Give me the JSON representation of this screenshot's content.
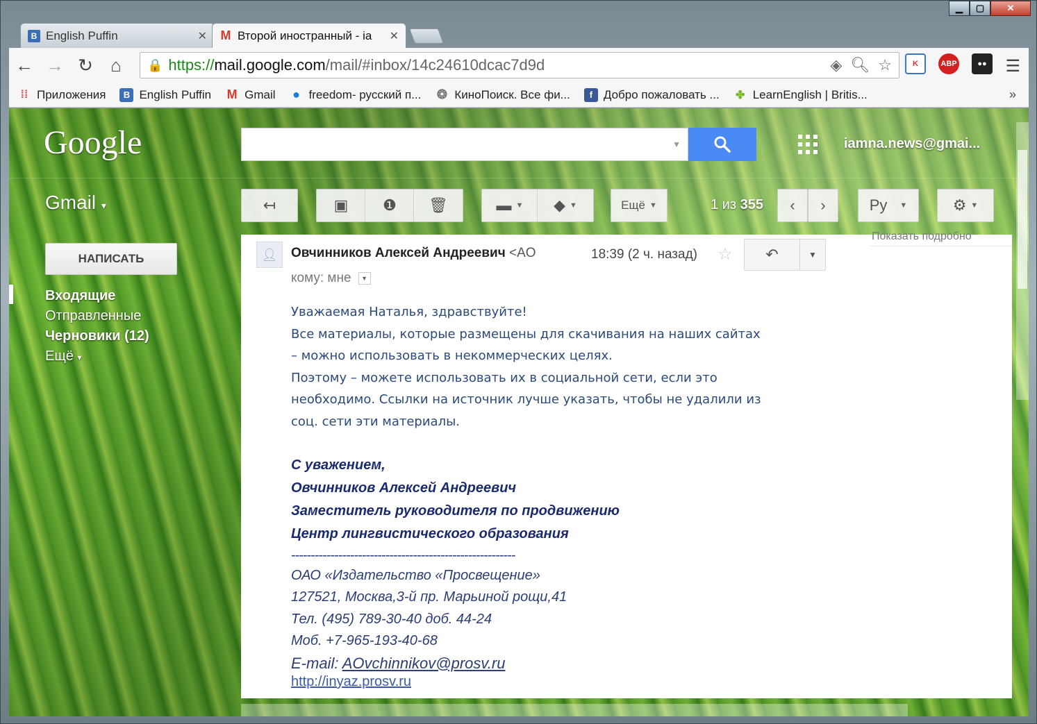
{
  "browser": {
    "tabs": [
      {
        "title": "English Puffin",
        "favicon": "B"
      },
      {
        "title": "Второй иностранный - ia",
        "favicon": "M"
      }
    ],
    "url": {
      "scheme": "https://",
      "host": "mail.google.com",
      "path": "/mail/#inbox/14c24610dcac7d9d"
    },
    "bookmarks": [
      {
        "label": "Приложения",
        "icon": "apps-icon"
      },
      {
        "label": "English Puffin",
        "icon": "blogger-icon"
      },
      {
        "label": "Gmail",
        "icon": "gmail-icon"
      },
      {
        "label": "freedom- русский п...",
        "icon": "chat-bubble-icon"
      },
      {
        "label": "КиноПоиск. Все фи...",
        "icon": "film-reel-icon"
      },
      {
        "label": "Добро пожаловать ...",
        "icon": "facebook-icon"
      },
      {
        "label": "LearnEnglish | Britis...",
        "icon": "learnenglish-icon"
      }
    ],
    "bookmarks_more": "»"
  },
  "gmail": {
    "logo": "Google",
    "account": "iamna.news@gmai...",
    "app_label": "Gmail",
    "compose_label": "НАПИСАТЬ",
    "folders": [
      {
        "label": "Входящие",
        "bold": true
      },
      {
        "label": "Отправленные",
        "bold": false
      },
      {
        "label": "Черновики (12)",
        "bold": true
      },
      {
        "label": "Ещё",
        "bold": false
      }
    ],
    "toolbar": {
      "more_label": "Ещё",
      "pager_prefix": "1 из ",
      "pager_total": "355",
      "lang_label": "Ру"
    }
  },
  "message": {
    "sender_name": "Овчинников Алексей Андреевич",
    "sender_addr": " <AO",
    "time": "18:39 (2 ч. назад)",
    "to_line": "кому: мне",
    "side_link": "Показать подробно",
    "body_lines": [
      "Уважаемая Наталья, здравствуйте!",
      "Все материалы, которые размещены для скачивания на наших сайтах",
      "– можно использовать в некоммерческих целях.",
      "Поэтому – можете использовать их в социальной сети, если это",
      "необходимо. Ссылки на источник лучше указать, чтобы не удалили из",
      "соц. сети эти материалы."
    ],
    "signature": [
      "С уважением,",
      "Овчинников Алексей Андреевич",
      "Заместитель руководителя по продвижению",
      "Центр лингвистического образования"
    ],
    "separator": "---------------------------------------------------------",
    "contact": [
      "ОАО «Издательство «Просвещение»",
      "127521, Москва,3-й пр. Марьиной рощи,41",
      "Тел.  (495) 789-30-40  доб. 44-24",
      "Моб. +7-965-193-40-68"
    ],
    "email_label": "E-mail: ",
    "email": "AOvchinnikov@prosv.ru",
    "site": "http://inyaz.prosv.ru"
  }
}
